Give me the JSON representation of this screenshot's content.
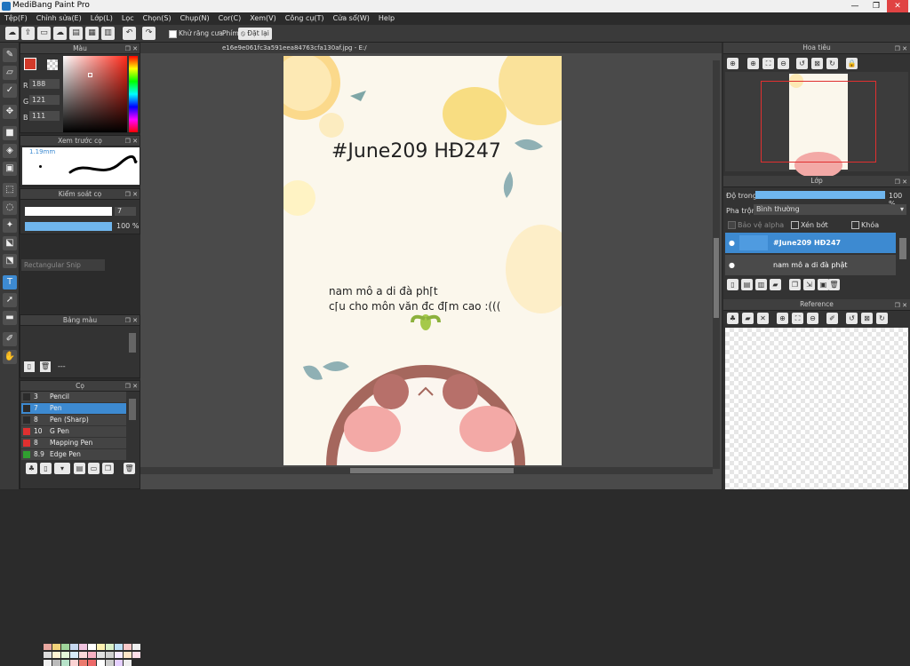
{
  "window": {
    "title": "MediBang Paint Pro",
    "min": "—",
    "max": "❐",
    "close": "✕"
  },
  "menu": [
    "Tệp(F)",
    "Chỉnh sửa(E)",
    "Lớp(L)",
    "Lọc",
    "Chọn(S)",
    "Chụp(N)",
    "Cor(C)",
    "Xem(V)",
    "Công cụ(T)",
    "Cửa sổ(W)",
    "Help"
  ],
  "toolbar": {
    "antialias_label": "Khử răng cưa",
    "key_label": "Phím",
    "reset_label": "Đặt lại"
  },
  "color_panel": {
    "title": "Màu",
    "r_label": "R",
    "g_label": "G",
    "b_label": "B",
    "r": "188",
    "g": "121",
    "b": "111",
    "fg": "#bc796f",
    "accent": "#d23a2a"
  },
  "brush_preview": {
    "title": "Xem trước cọ",
    "size": "1.19mm"
  },
  "brush_control": {
    "title": "Kiểm soát cọ",
    "size_value": "7",
    "opacity_value": "100 %"
  },
  "tooltip": "Rectangular Snip",
  "palette": {
    "title": "Bảng màu",
    "dots": "---",
    "colors": [
      "#e8a7a0",
      "#f2d37a",
      "#9fd49a",
      "#c7d8f0",
      "#f0c4e0",
      "#ffffff",
      "#fdf0b0",
      "#d9f0c8",
      "#bde0f5",
      "#f7c9c9",
      "#eeeeee",
      "#dddddd",
      "#fff4d4",
      "#e6f7da",
      "#d8ecf8",
      "#fbdada",
      "#f7b2c4",
      "#e0e0e0",
      "#cfcfcf",
      "#f5e9ff",
      "#fde5c7",
      "#ffe0e9",
      "#f0f0f0",
      "#bbbbbb",
      "#b7e3c9",
      "#fbd3d3",
      "#eb7a6e",
      "#ed6969",
      "#ffffff",
      "#cccccc",
      "#e5d0ff",
      "#eeeeee"
    ]
  },
  "brush_panel": {
    "title": "Cọ",
    "items": [
      {
        "num": "3",
        "name": "Pencil",
        "color": "#2b2b2b",
        "selected": false
      },
      {
        "num": "7",
        "name": "Pen",
        "color": "#2b2b2b",
        "selected": true
      },
      {
        "num": "8",
        "name": "Pen (Sharp)",
        "color": "#2b2b2b",
        "selected": false
      },
      {
        "num": "10",
        "name": "G Pen",
        "color": "#e03030",
        "selected": false
      },
      {
        "num": "8",
        "name": "Mapping Pen",
        "color": "#e03030",
        "selected": false
      },
      {
        "num": "8.9",
        "name": "Edge Pen",
        "color": "#30a030",
        "selected": false
      }
    ]
  },
  "document": {
    "tab_title": "e16e9e061fc3a591eea84763cfa130af.jpg - E:/"
  },
  "canvas": {
    "hashtag": "#June209  HĐ247",
    "line1": "nam mô a di đà ph⌈t",
    "line2": "c⌈u cho môn văn đc đ⌈m cao :((("
  },
  "navigator": {
    "title": "Hoa tiêu"
  },
  "layer_panel": {
    "title": "Lớp",
    "opacity_label": "Độ trong",
    "opacity_value": "100 %",
    "opacity_fraction": 1.0,
    "blend_label": "Pha trộn",
    "blend_value": "Bình thường",
    "protect_alpha": "Bảo vệ alpha",
    "clip": "Xén bớt",
    "lock": "Khóa",
    "layers": [
      {
        "name": "#June209 HĐ247",
        "selected": true
      },
      {
        "name": "nam mô a di đà phật",
        "selected": false
      }
    ]
  },
  "reference": {
    "title": "Reference"
  }
}
